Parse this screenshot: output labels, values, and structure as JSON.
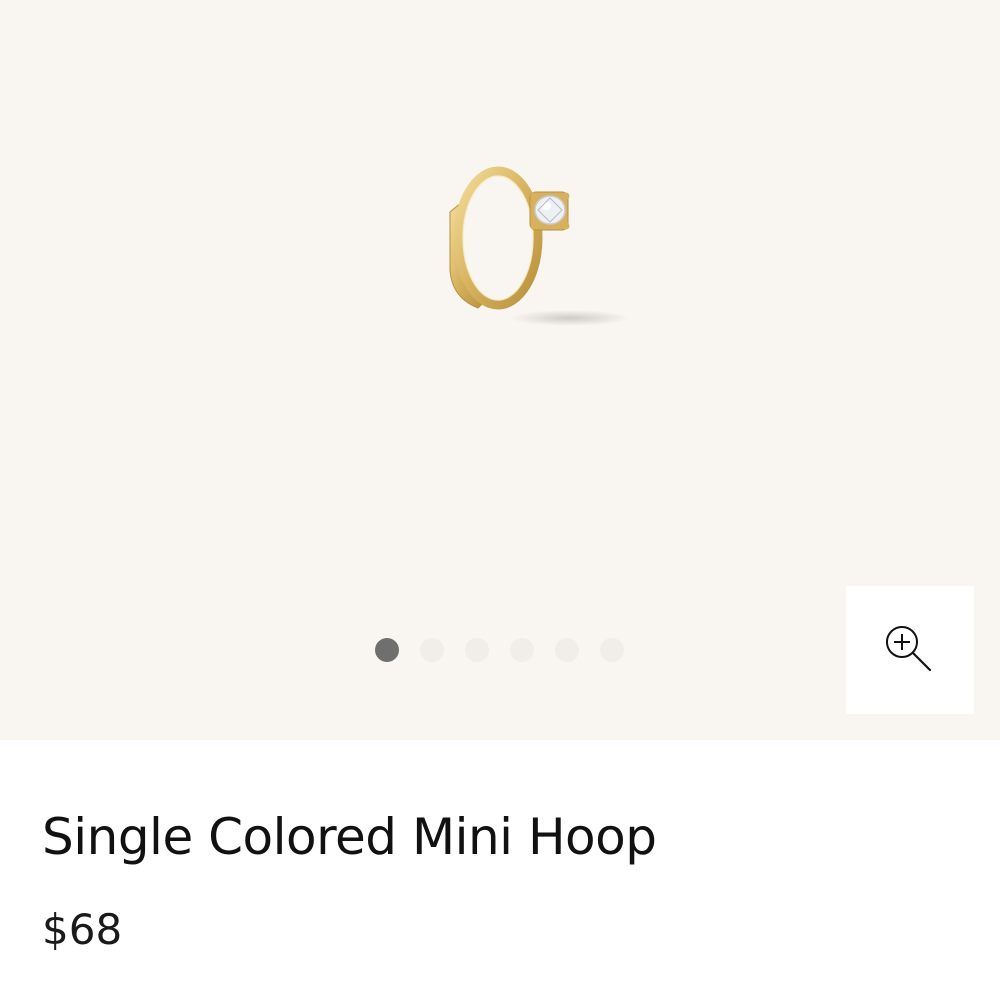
{
  "product": {
    "title": "Single Colored Mini Hoop",
    "price": "$68"
  },
  "gallery": {
    "image_count": 6,
    "active_index": 0,
    "zoom_icon": "zoom-in-icon"
  },
  "colors": {
    "gallery_background": "#f9f6f2",
    "gold": "#d9b664",
    "active_dot": "#6f6f6f",
    "inactive_dot": "#f1eeea"
  }
}
